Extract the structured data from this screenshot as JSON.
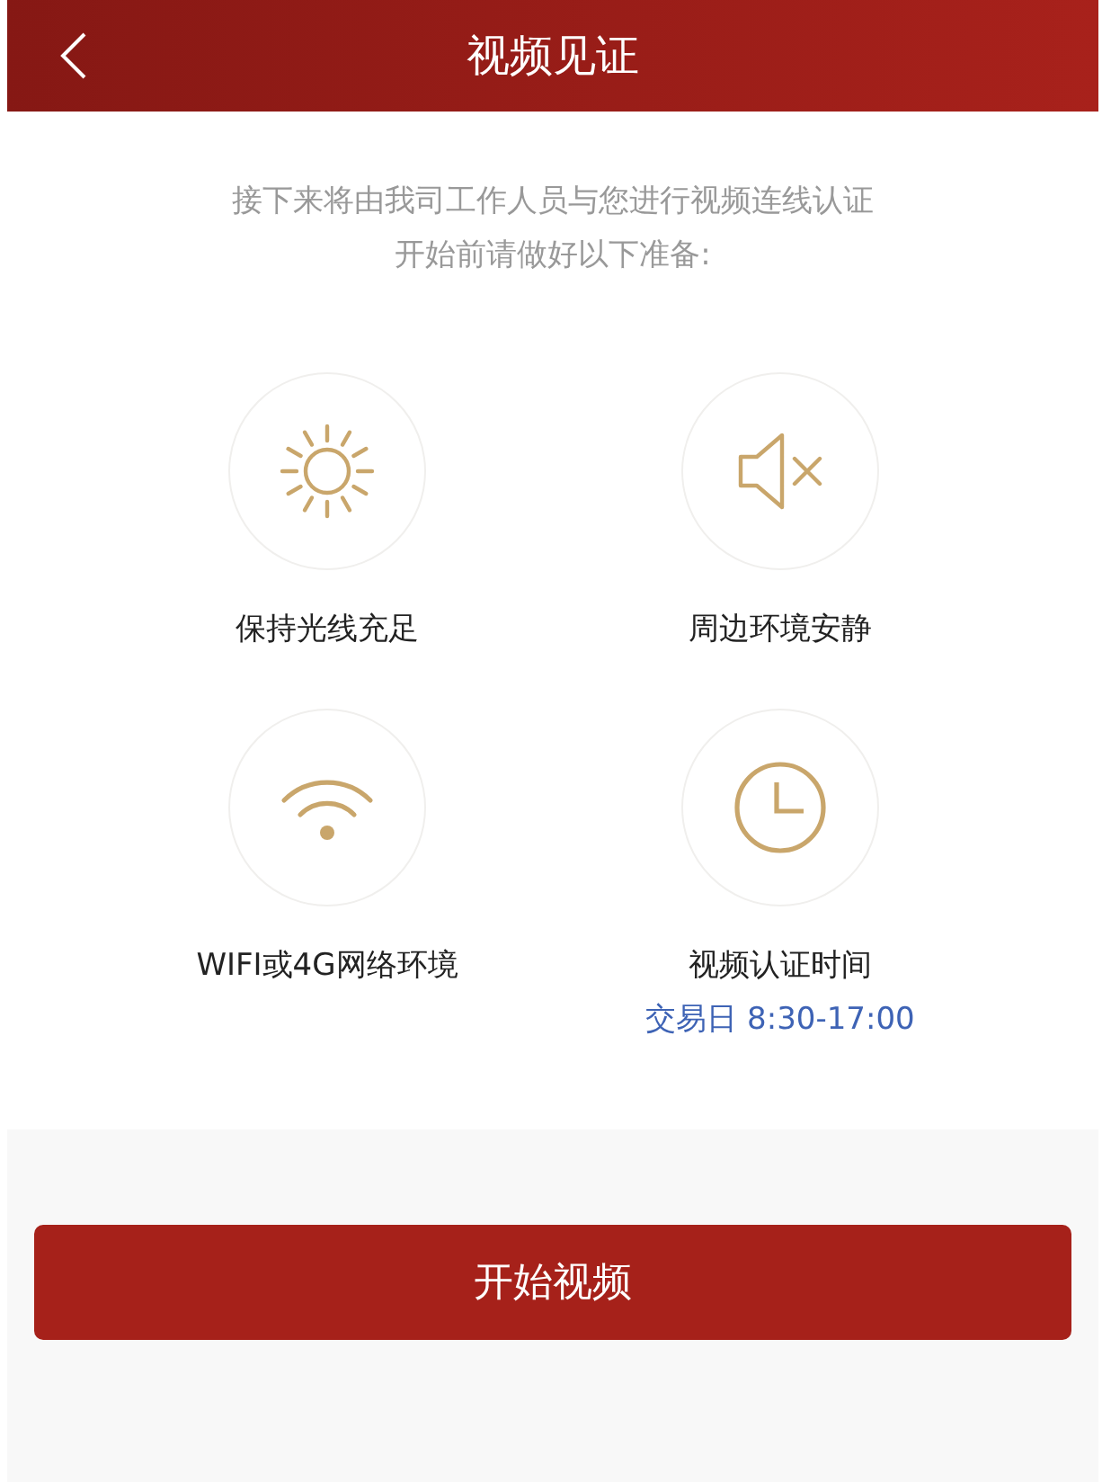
{
  "header": {
    "title": "视频见证"
  },
  "intro": [
    "接下来将由我司工作人员与您进行视频连线认证",
    "开始前请做好以下准备:"
  ],
  "tips": [
    {
      "kind": "sun",
      "label": "保持光线充足"
    },
    {
      "kind": "mute",
      "label": "周边环境安静"
    },
    {
      "kind": "wifi",
      "label": "WIFI或4G网络环境"
    },
    {
      "kind": "clock",
      "label": "视频认证时间",
      "note": "交易日 8:30-17:00"
    }
  ],
  "button": {
    "label": "开始视频"
  }
}
